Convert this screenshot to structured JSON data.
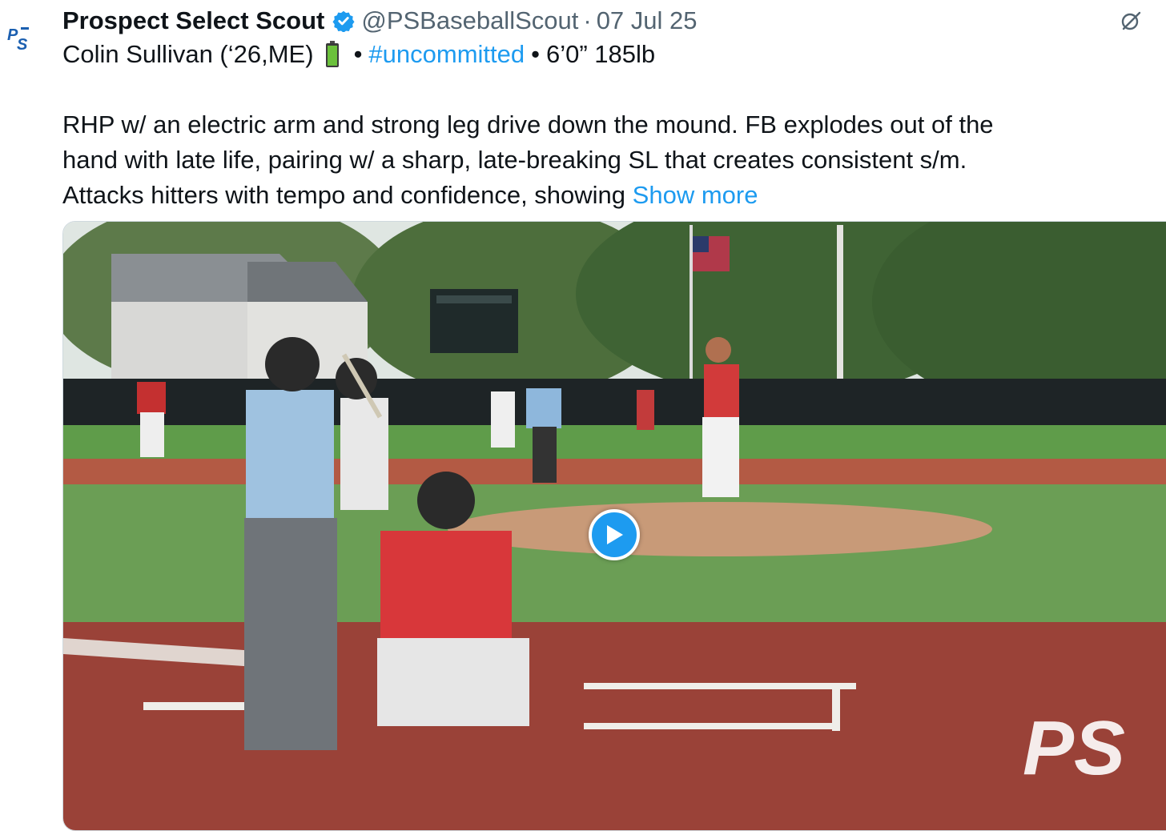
{
  "tweet": {
    "author_name": "Prospect Select Scout",
    "author_handle": "@PSBaseballScout",
    "separator": "·",
    "date": "07 Jul 25",
    "avatar_icon": "ps-logo-icon",
    "verified_icon": "verified-badge-icon",
    "more_icon": "grok-icon",
    "subline": {
      "player": "Colin Sullivan (‘26,ME)",
      "battery_icon": "battery-emoji-icon",
      "bullet1": "•",
      "hashtag": "#uncommitted",
      "bullet2": "•",
      "size": "6’0” 185lb"
    },
    "body": {
      "line1": "RHP w/ an electric arm and strong leg drive down the mound. FB explodes out of the",
      "line2": "hand with late life, pairing w/ a sharp, late-breaking SL that creates consistent s/m.",
      "line3": "Attacks hitters with tempo and confidence, showing ",
      "show_more": "Show more"
    },
    "media": {
      "play_icon": "play-icon",
      "watermark_text": "PS"
    },
    "colors": {
      "accent": "#1d9bf0",
      "secondary_text": "#536471",
      "primary_text": "#0f1419",
      "verified": "#1d9bf0"
    }
  }
}
